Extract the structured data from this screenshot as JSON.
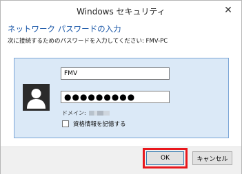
{
  "window": {
    "title": "Windows セキュリティ",
    "close_glyph": "✕"
  },
  "dialog": {
    "heading": "ネットワーク パスワードの入力",
    "instruction": "次に接続するためのパスワードを入力してください: FMV-PC"
  },
  "credentials": {
    "username_value": "FMV",
    "password_value": "●●●●●●●●●",
    "domain_label": "ドメイン:",
    "remember_label": "資格情報を記憶する",
    "remember_checked": false
  },
  "buttons": {
    "ok_label": "OK",
    "cancel_label": "キャンセル"
  },
  "colors": {
    "heading_blue": "#1a57a8",
    "panel_bg": "#dbe9f7",
    "highlight_red": "#e8171c"
  },
  "icons": {
    "avatar": "user-silhouette-icon",
    "close": "close-icon",
    "checkbox": "checkbox-unchecked"
  }
}
